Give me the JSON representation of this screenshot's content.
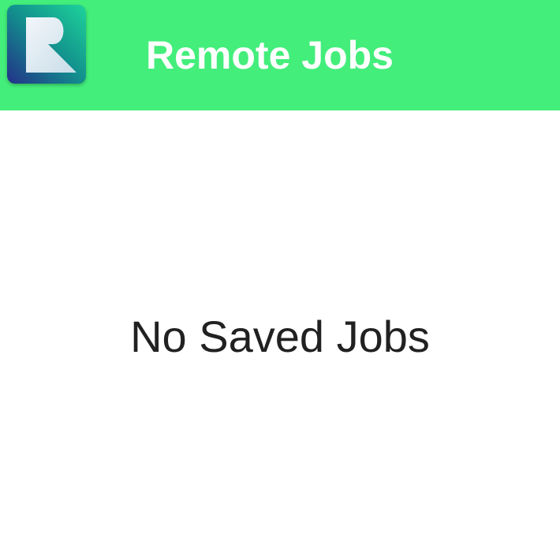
{
  "app_bar": {
    "title": "Remote Jobs",
    "logo_icon": "remote-jobs-logo-icon",
    "background_color": "#43ee7b"
  },
  "main": {
    "empty_message": "No Saved Jobs"
  }
}
